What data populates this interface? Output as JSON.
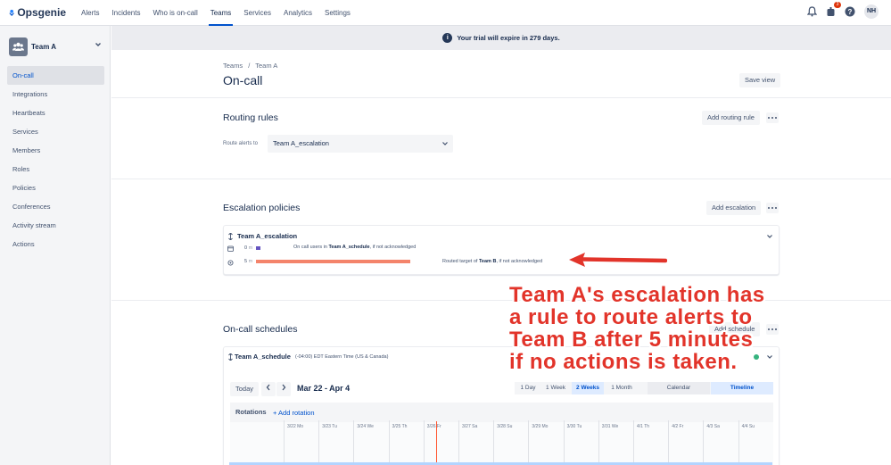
{
  "brand": {
    "name": "Opsgenie"
  },
  "nav": {
    "items": [
      "Alerts",
      "Incidents",
      "Who is on-call",
      "Teams",
      "Services",
      "Analytics",
      "Settings"
    ],
    "active": "Teams",
    "notification_count": "3",
    "avatar_initials": "NH"
  },
  "banner": {
    "text": "Your trial will expire in 279 days."
  },
  "sidebar": {
    "team_name": "Team A",
    "items": [
      "On-call",
      "Integrations",
      "Heartbeats",
      "Services",
      "Members",
      "Roles",
      "Policies",
      "Conferences",
      "Activity stream",
      "Actions"
    ],
    "active": "On-call"
  },
  "breadcrumb": {
    "parent": "Teams",
    "separator": "/",
    "current": "Team A"
  },
  "page": {
    "title": "On-call",
    "save_view": "Save view"
  },
  "routing": {
    "title": "Routing rules",
    "add_button": "Add routing rule",
    "route_label": "Route alerts to",
    "route_value": "Team A_escalation"
  },
  "escalation": {
    "title": "Escalation policies",
    "add_button": "Add escalation",
    "policy_name": "Team A_escalation",
    "rule1": {
      "minute": "0",
      "unit": "m",
      "prefix": "On call users in ",
      "target": "Team A_schedule",
      "suffix": ", if not acknowledged"
    },
    "rule2": {
      "minute": "5",
      "unit": "m",
      "prefix": "Routed target of ",
      "target": "Team B",
      "suffix": ", if not acknowledged"
    }
  },
  "schedules": {
    "title": "On-call schedules",
    "add_button": "Add schedule",
    "schedule_name": "Team A_schedule",
    "timezone": "(-04:00) EDT Eastern Time (US & Canada)",
    "today_button": "Today",
    "date_range": "Mar 22 - Apr 4",
    "ranges": [
      "1 Day",
      "1 Week",
      "2 Weeks",
      "1 Month"
    ],
    "selected_range": "2 Weeks",
    "views": [
      "Calendar",
      "Timeline"
    ],
    "selected_view": "Timeline",
    "rotations_label": "Rotations",
    "add_rotation": "+ Add rotation",
    "days": [
      "3/22 Mo",
      "3/23 Tu",
      "3/24 We",
      "3/25 Th",
      "3/26 Fr",
      "3/27 Sa",
      "3/28 Su",
      "3/29 Mo",
      "3/30 Tu",
      "3/31 We",
      "4/1 Th",
      "4/2 Fr",
      "4/3 Sa",
      "4/4 Su"
    ]
  },
  "annotation": {
    "text": "Team A's escalation has a rule to route alerts to Team B after 5 minutes if no actions is taken."
  },
  "colors": {
    "accent": "#0052cc",
    "annotation": "#e2342a",
    "bar": "#f4846b"
  }
}
